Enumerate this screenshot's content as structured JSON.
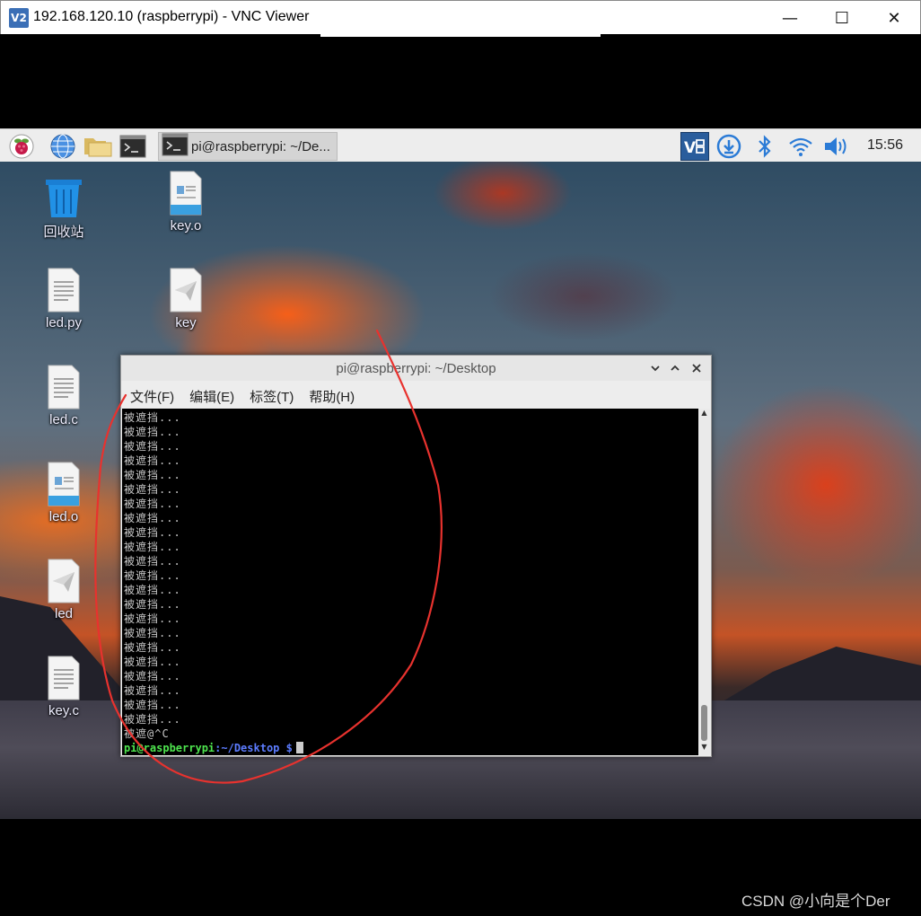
{
  "vnc_window": {
    "title": "192.168.120.10 (raspberrypi) - VNC Viewer",
    "logo": "V2",
    "controls": {
      "minimize": "—",
      "maximize": "☐",
      "close": "✕"
    }
  },
  "taskbar": {
    "launchers": [
      "raspberry-menu-icon",
      "browser-globe-icon",
      "file-manager-folder-icon",
      "terminal-icon"
    ],
    "active_task": "pi@raspberrypi: ~/De...",
    "tray": [
      "vnc-server-icon",
      "updater-icon",
      "bluetooth-icon",
      "wifi-icon",
      "volume-icon"
    ],
    "clock": "15:56"
  },
  "desktop": {
    "icons": [
      {
        "label": "回收站",
        "icon": "trash-icon"
      },
      {
        "label": "key.o",
        "icon": "object-file-icon"
      },
      {
        "label": "led.py",
        "icon": "text-file-icon"
      },
      {
        "label": "key",
        "icon": "executable-icon"
      },
      {
        "label": "led.c",
        "icon": "text-file-icon"
      },
      {
        "label": "led.o",
        "icon": "object-file-icon"
      },
      {
        "label": "led",
        "icon": "executable-icon"
      },
      {
        "label": "key.c",
        "icon": "text-file-icon"
      }
    ]
  },
  "terminal": {
    "title": "pi@raspberrypi: ~/Desktop",
    "menu": [
      "文件(F)",
      "编辑(E)",
      "标签(T)",
      "帮助(H)"
    ],
    "output_line": "被遮挡...",
    "output_count": 22,
    "interrupt_line": "被遮@^C",
    "prompt_user": "pi@raspberrypi",
    "prompt_path": ":~/Desktop",
    "prompt_dollar": " $"
  },
  "watermark": "CSDN @小向是个Der",
  "colors": {
    "annotation": "#e8322e",
    "prompt_user": "#4ee44e",
    "prompt_path": "#5c7cff"
  }
}
